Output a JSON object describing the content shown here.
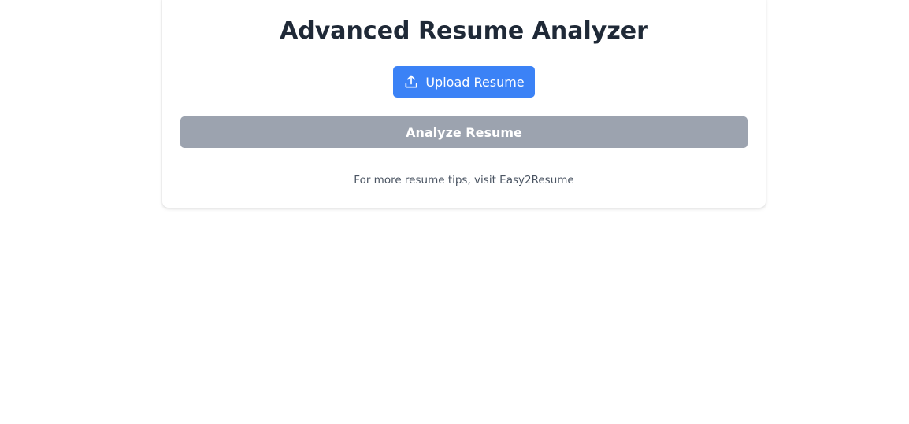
{
  "page": {
    "title": "Advanced Resume Analyzer"
  },
  "upload": {
    "label": "Upload Resume",
    "icon": "upload-icon"
  },
  "analyze": {
    "label": "Analyze Resume",
    "state": "disabled"
  },
  "footer": {
    "text": "For more resume tips, visit Easy2Resume"
  },
  "colors": {
    "primary": "#3b82f6",
    "disabled": "#9ca3af",
    "title": "#1f2937",
    "muted": "#4b5563",
    "background": "#ffffff"
  }
}
